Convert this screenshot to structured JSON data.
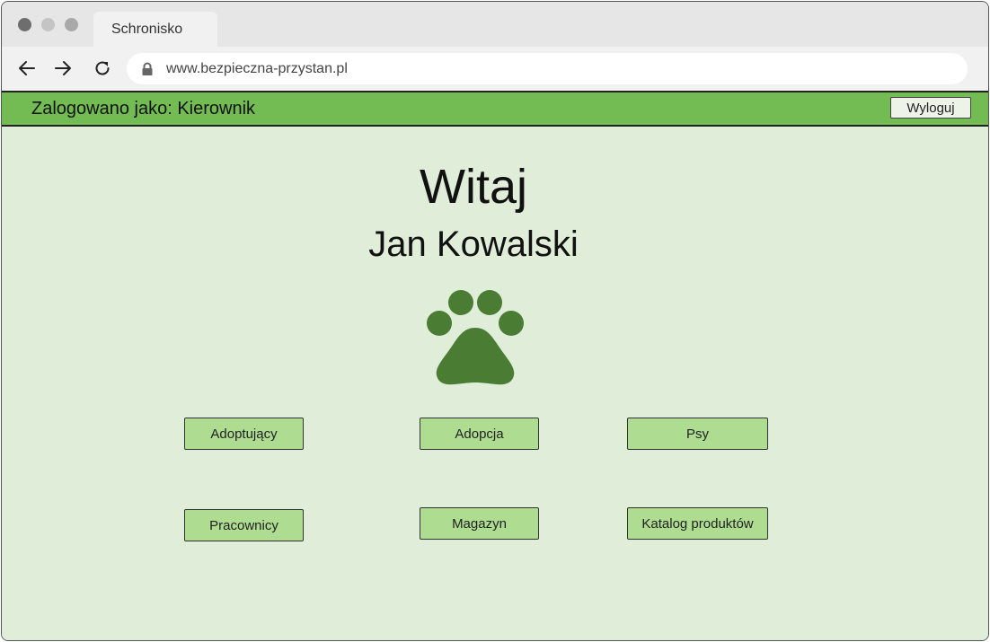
{
  "browser": {
    "tab_title": "Schronisko",
    "url": "www.bezpieczna-przystan.pl",
    "icons": {
      "back": "back-arrow-icon",
      "forward": "forward-arrow-icon",
      "reload": "reload-icon",
      "lock": "lock-icon"
    }
  },
  "header": {
    "logged_in_text": "Zalogowano jako: Kierownik",
    "logout_label": "Wyloguj"
  },
  "main": {
    "welcome": "Witaj",
    "user_name": "Jan Kowalski",
    "logo_icon": "paw-icon",
    "buttons": [
      {
        "label": "Adoptujący"
      },
      {
        "label": "Adopcja"
      },
      {
        "label": "Psy"
      },
      {
        "label": "Pracownicy"
      },
      {
        "label": "Magazyn"
      },
      {
        "label": "Katalog produktów"
      }
    ]
  },
  "colors": {
    "header_green": "#72bc53",
    "page_background": "#e0edd8",
    "button_green": "#aedd92",
    "paw_green": "#4a7c34"
  }
}
